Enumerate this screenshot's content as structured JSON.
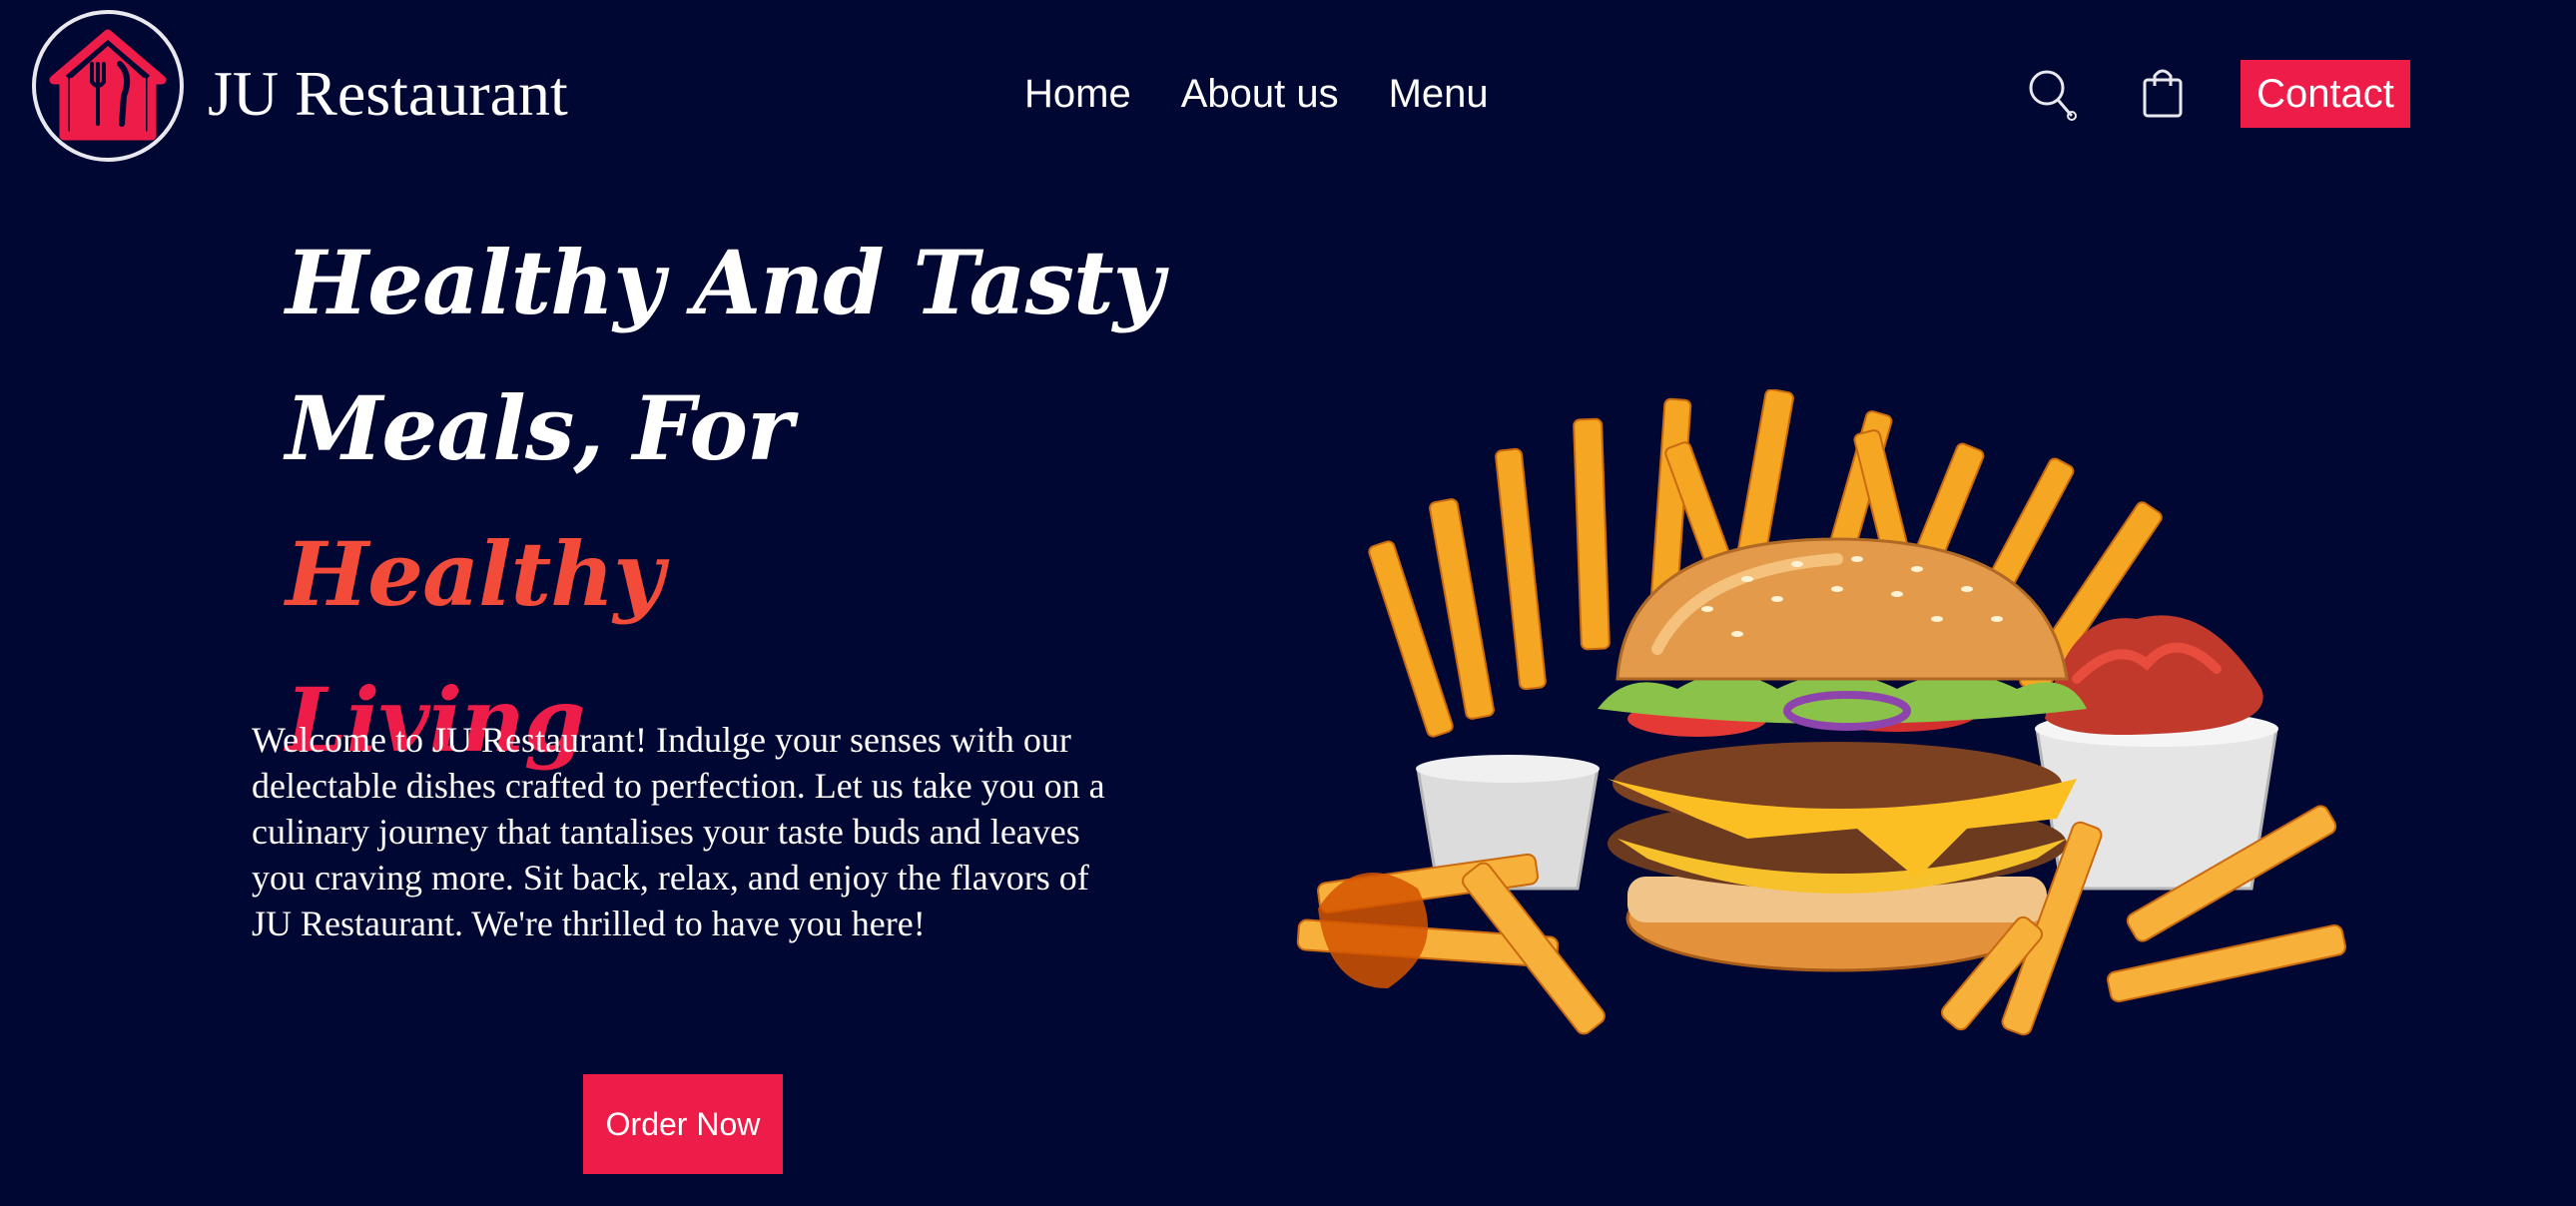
{
  "brand": {
    "name": "JU Restaurant"
  },
  "nav": {
    "items": [
      {
        "label": "Home"
      },
      {
        "label": "About us"
      },
      {
        "label": "Menu"
      }
    ]
  },
  "header": {
    "contact_label": "Contact"
  },
  "icons": {
    "logo": "house-fork-knife-icon",
    "search": "search-icon",
    "cart": "shopping-bag-icon"
  },
  "hero": {
    "headline_part1": "Healthy And Tasty",
    "headline_part2": "Meals, For",
    "headline_part3": "Healthy",
    "headline_part4": "Living",
    "intro": "Welcome to JU Restaurant! Indulge your senses with our delectable dishes crafted to perfection. Let us take you on a culinary journey that tantalises your taste buds and leaves you craving more. Sit back, relax, and enjoy the flavors of JU Restaurant. We're thrilled to have you here!",
    "order_label": "Order Now",
    "image": "burger-and-fries-image"
  },
  "colors": {
    "background": "#000733",
    "accent": "#ee1c48",
    "highlight": "#f24b3a",
    "text": "#ffffff"
  }
}
